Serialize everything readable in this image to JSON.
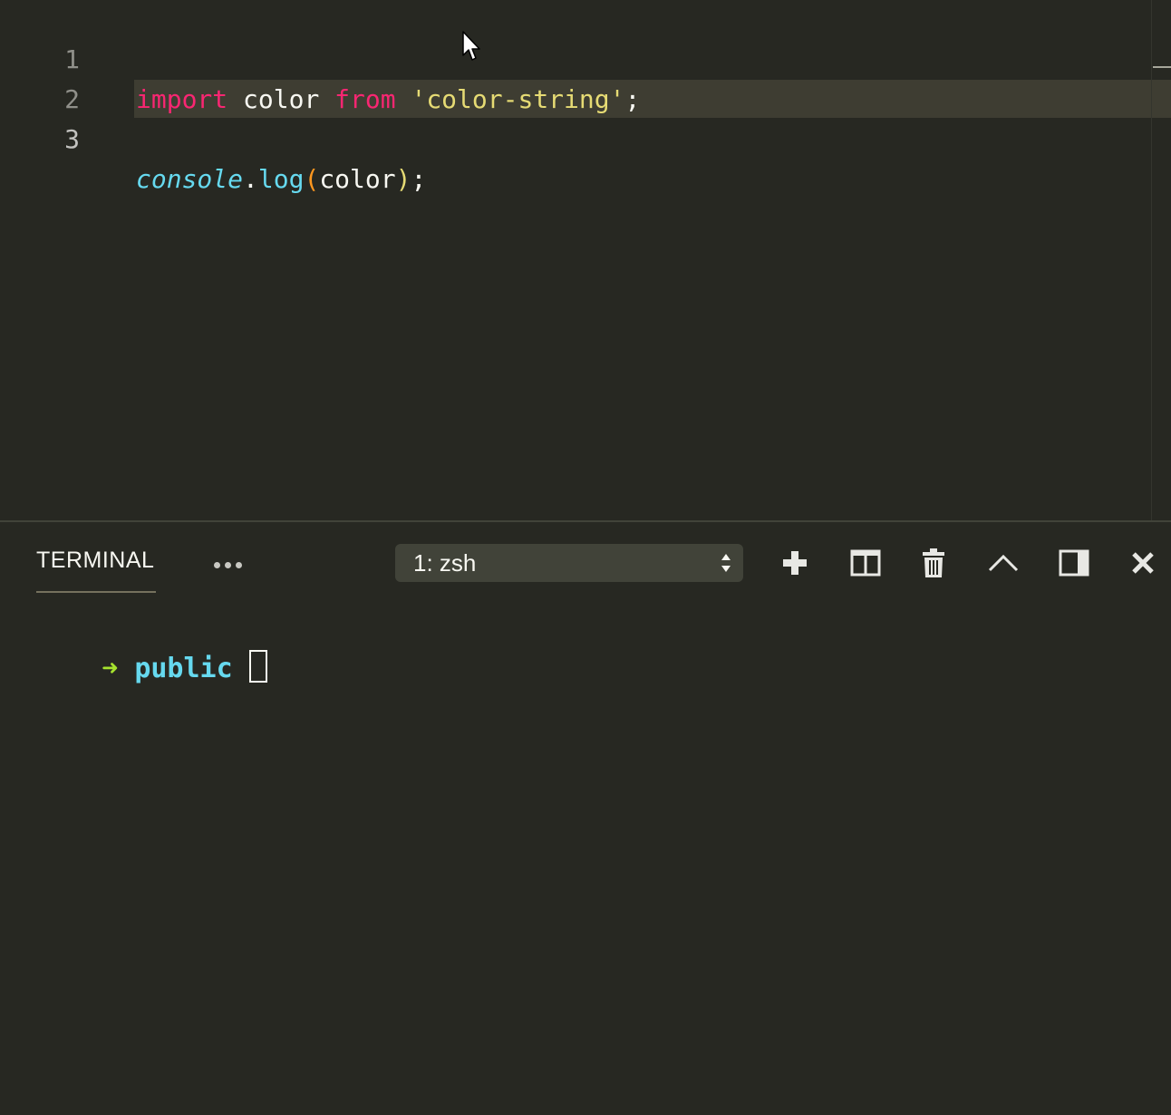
{
  "editor": {
    "lines": [
      {
        "number": "1",
        "tokens": {
          "import": "import",
          "space1": " ",
          "ident": "color",
          "space2": " ",
          "from": "from",
          "space3": " ",
          "string": "'color-string'",
          "semi": ";"
        }
      },
      {
        "number": "2"
      },
      {
        "number": "3",
        "tokens": {
          "object": "console",
          "dot": ".",
          "method": "log",
          "lparen": "(",
          "arg": "color",
          "rparen": ")",
          "semi": ";"
        }
      }
    ]
  },
  "panel": {
    "tab_label": "TERMINAL",
    "terminal_selector": {
      "selected": "1: zsh"
    },
    "actions": [
      "new-terminal",
      "split-terminal",
      "kill-terminal",
      "maximize-panel",
      "toggle-panel-position",
      "close-panel"
    ]
  },
  "terminal": {
    "prompt_symbol": "➜",
    "directory": "public"
  },
  "colors": {
    "background": "#272822",
    "keyword": "#f92672",
    "string": "#e6db74",
    "function": "#66d9ef",
    "prompt_arrow": "#a6e22e"
  }
}
